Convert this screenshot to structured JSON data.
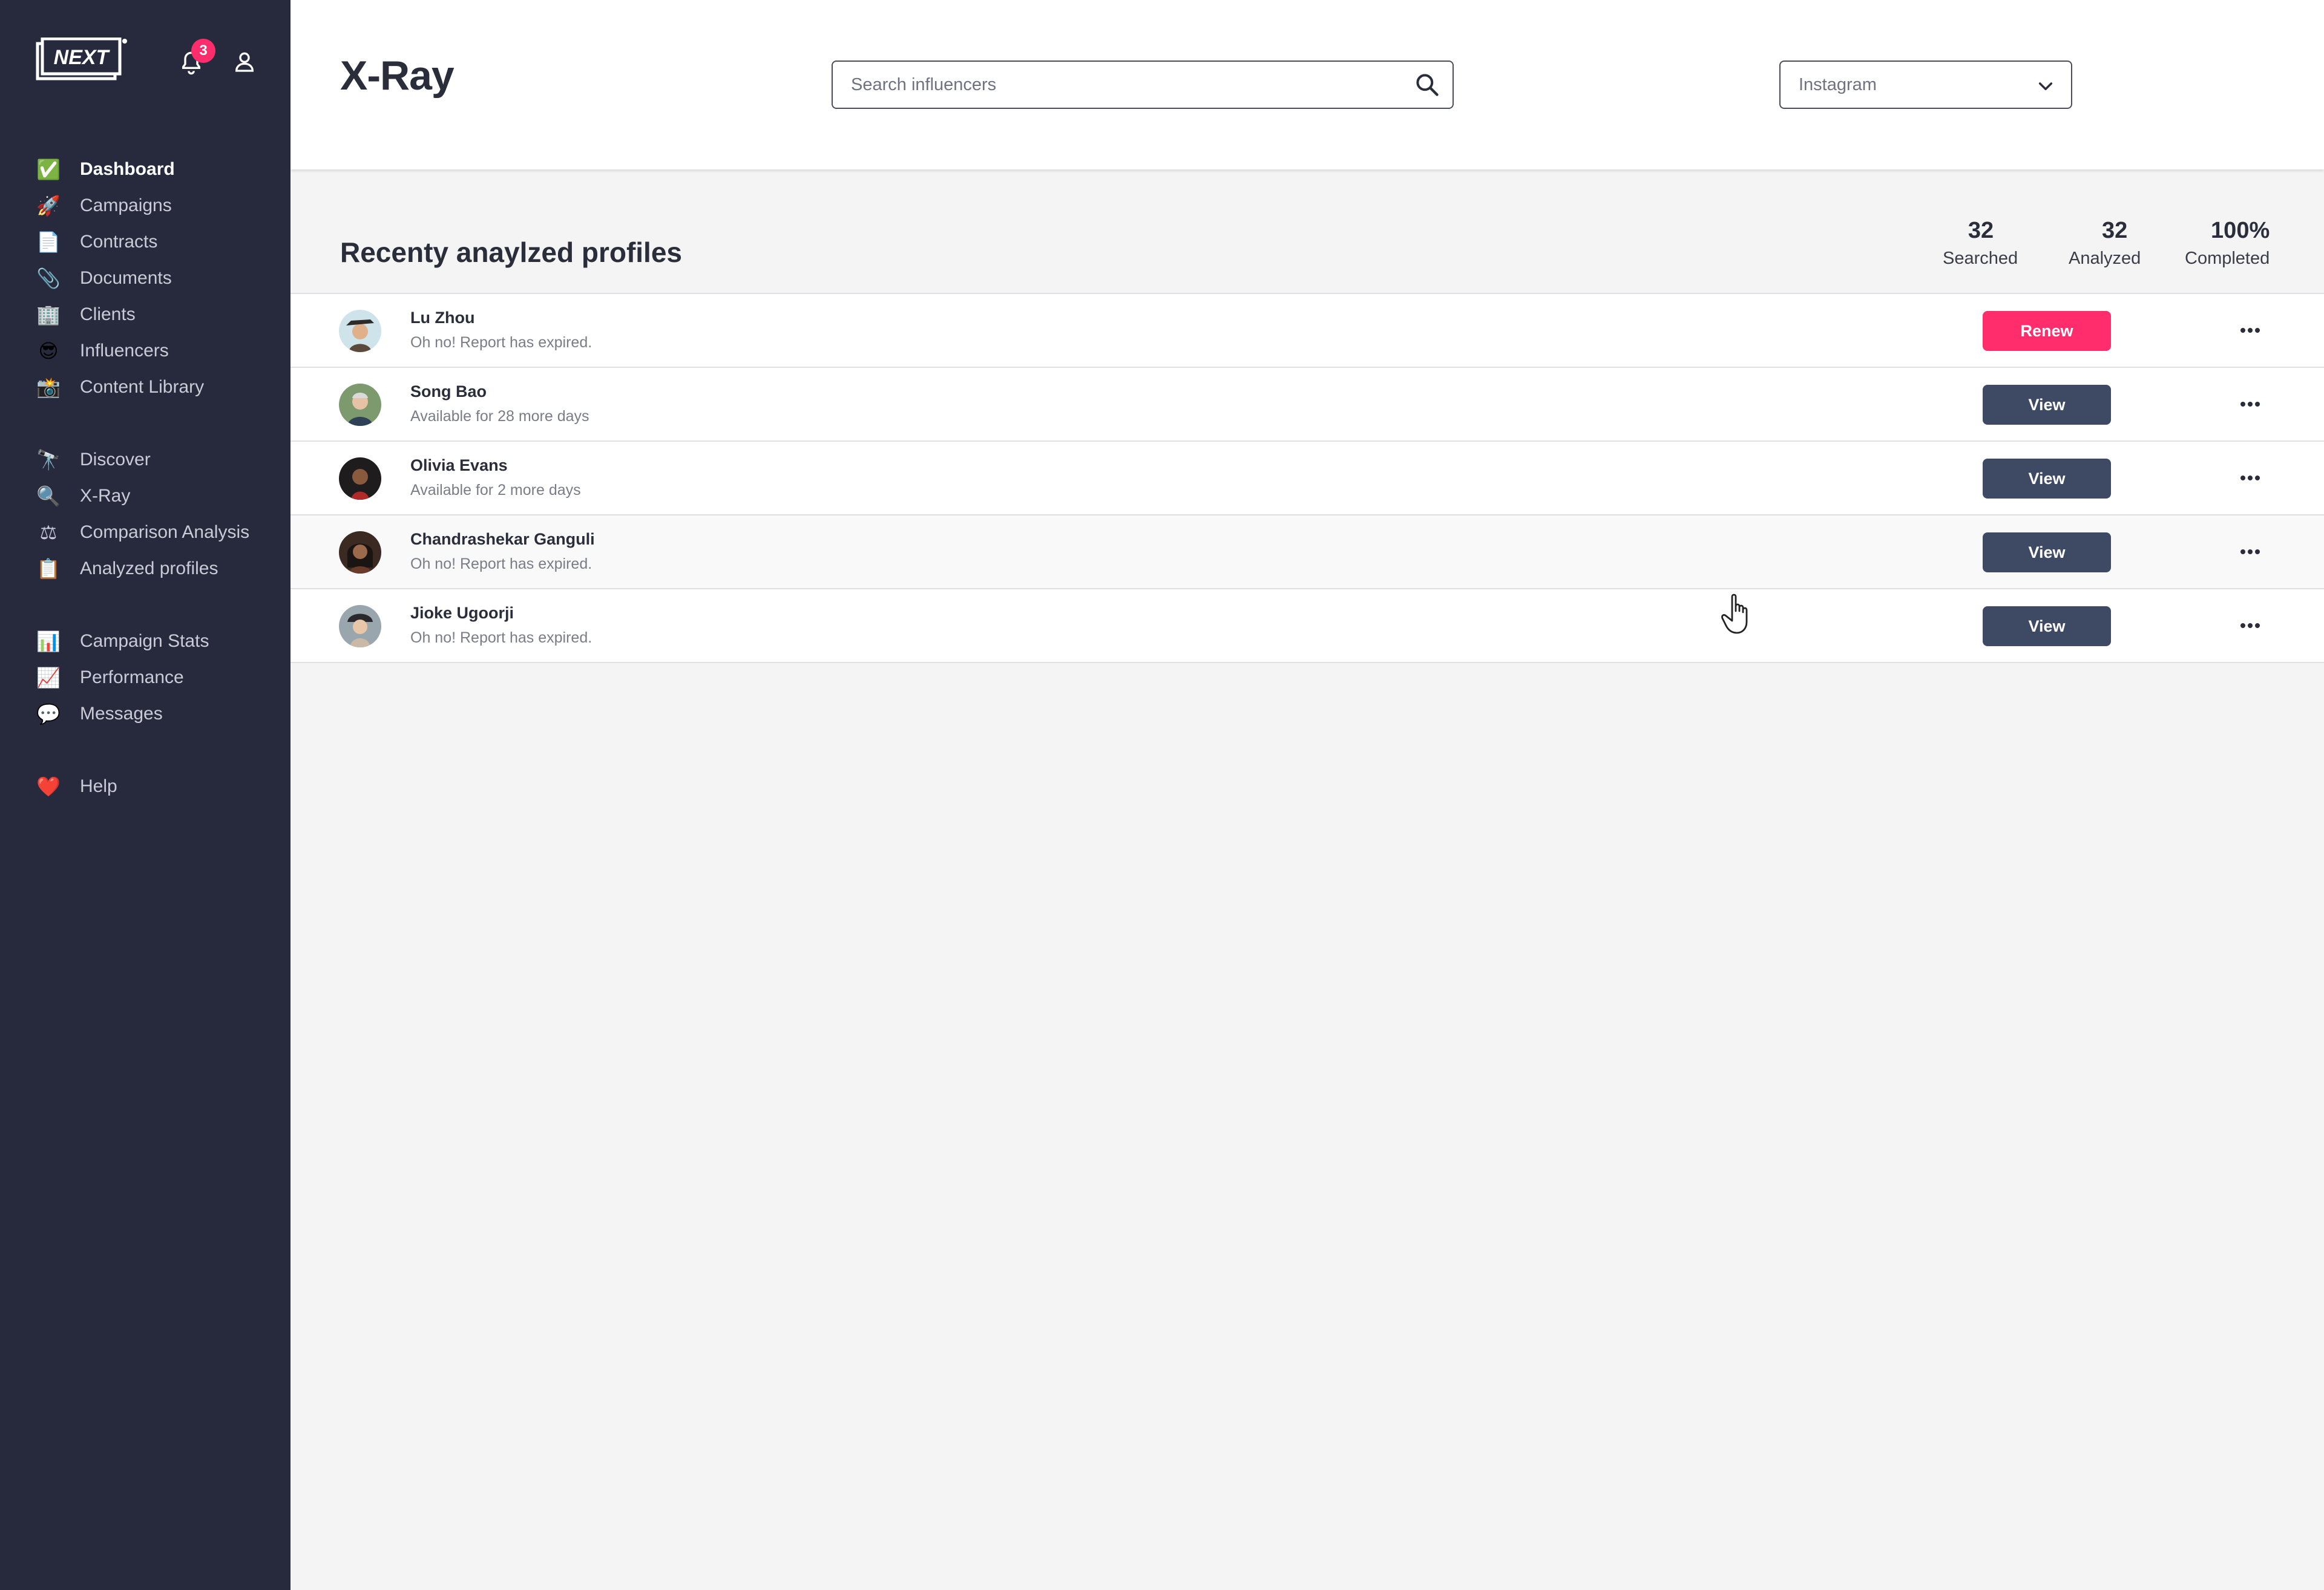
{
  "sidebar": {
    "logo_text": "NEXT",
    "notification_count": "3",
    "items": [
      {
        "label": "Dashboard",
        "icon": "check-box-icon",
        "glyph": "✅"
      },
      {
        "label": "Campaigns",
        "icon": "rocket-icon",
        "glyph": "🚀"
      },
      {
        "label": "Contracts",
        "icon": "page-icon",
        "glyph": "📄"
      },
      {
        "label": "Documents",
        "icon": "paperclip-icon",
        "glyph": "📎"
      },
      {
        "label": "Clients",
        "icon": "building-icon",
        "glyph": "🏢"
      },
      {
        "label": "Influencers",
        "icon": "sunglasses-icon",
        "glyph": "😎"
      },
      {
        "label": "Content Library",
        "icon": "camera-icon",
        "glyph": "📸"
      },
      {
        "label": "Discover",
        "icon": "telescope-icon",
        "glyph": "🔭"
      },
      {
        "label": "X-Ray",
        "icon": "magnifier-icon",
        "glyph": "🔍"
      },
      {
        "label": "Comparison Analysis",
        "icon": "scales-icon",
        "glyph": "⚖"
      },
      {
        "label": "Analyzed profiles",
        "icon": "clipboard-icon",
        "glyph": "📋"
      },
      {
        "label": "Campaign Stats",
        "icon": "bar-chart-icon",
        "glyph": "📊"
      },
      {
        "label": "Performance",
        "icon": "trend-chart-icon",
        "glyph": "📈"
      },
      {
        "label": "Messages",
        "icon": "speech-bubble-icon",
        "glyph": "💬"
      },
      {
        "label": "Help",
        "icon": "heart-icon",
        "glyph": "❤️"
      }
    ]
  },
  "header": {
    "title": "X-Ray",
    "search_placeholder": "Search influencers",
    "platform": "Instagram"
  },
  "section": {
    "title": "Recenty anaylzed profiles",
    "stats": [
      {
        "value": "32",
        "label": "Searched"
      },
      {
        "value": "32",
        "label": "Analyzed"
      },
      {
        "value": "100%",
        "label": "Completed"
      }
    ]
  },
  "profiles": [
    {
      "name": "Lu Zhou",
      "status": "Oh no! Report has expired.",
      "action": "Renew",
      "action_type": "renew"
    },
    {
      "name": "Song Bao",
      "status": "Available for 28 more days",
      "action": "View",
      "action_type": "view"
    },
    {
      "name": "Olivia Evans",
      "status": "Available for 2 more days",
      "action": "View",
      "action_type": "view"
    },
    {
      "name": "Chandrashekar Ganguli",
      "status": "Oh no! Report has expired.",
      "action": "View",
      "action_type": "view"
    },
    {
      "name": "Jioke Ugoorji",
      "status": "Oh no! Report has expired.",
      "action": "View",
      "action_type": "view"
    }
  ],
  "colors": {
    "sidebar_bg": "#272a3c",
    "accent_pink": "#ff2d6b",
    "view_button": "#3e4a63",
    "content_bg": "#f4f4f4"
  }
}
